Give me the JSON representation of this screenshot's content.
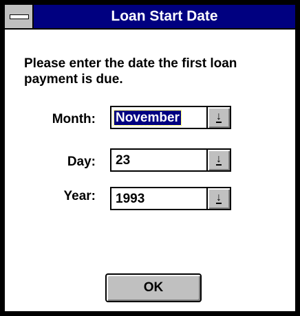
{
  "window": {
    "title": "Loan Start Date"
  },
  "dialog": {
    "prompt": "Please enter the date the first loan payment is due.",
    "month": {
      "label": "Month:",
      "value": "November"
    },
    "day": {
      "label": "Day:",
      "value": "23"
    },
    "year": {
      "label": "Year:",
      "value": "1993"
    },
    "ok_label": "OK"
  },
  "icons": {
    "system_menu": "system-menu-icon",
    "dropdown": "dropdown-arrow-icon"
  },
  "colors": {
    "titlebar": "#000080",
    "title_text": "#ffffff",
    "button_face": "#c0c0c0",
    "selection": "#000080"
  }
}
